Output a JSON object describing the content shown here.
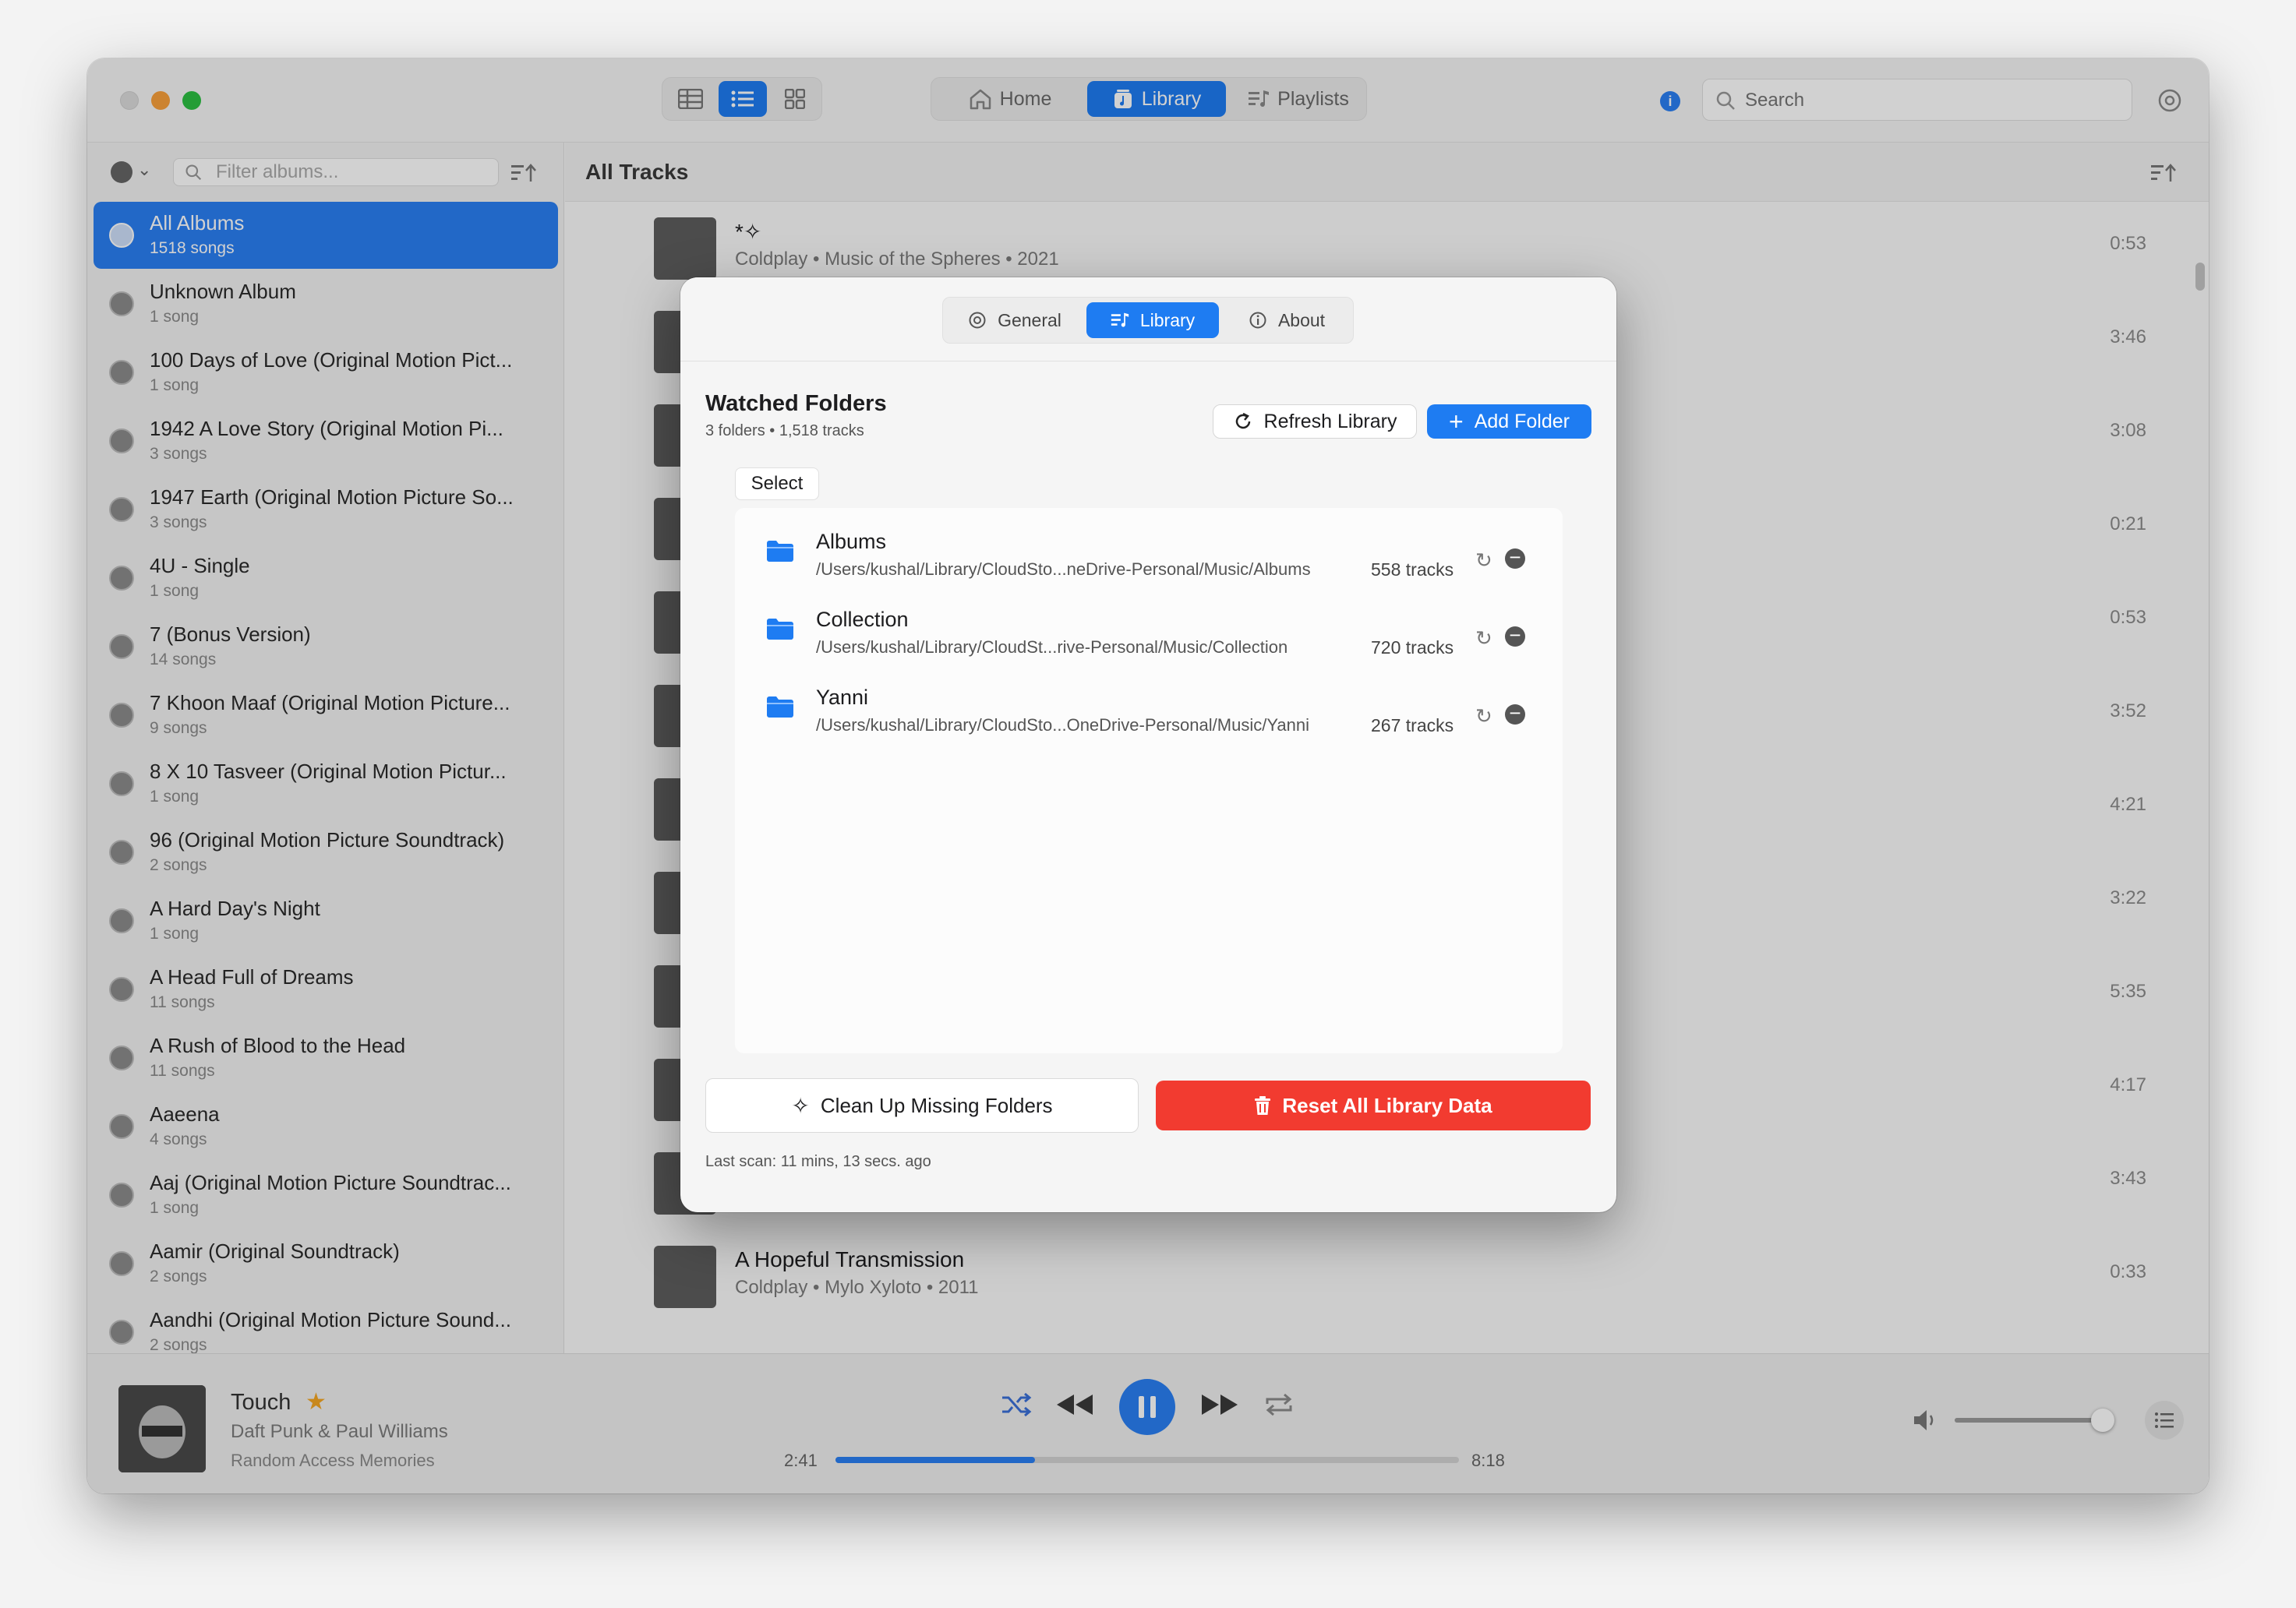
{
  "toolbar": {
    "nav_tabs": [
      {
        "label": "Home",
        "icon": "home-icon"
      },
      {
        "label": "Library",
        "icon": "library-icon"
      },
      {
        "label": "Playlists",
        "icon": "playlists-icon"
      }
    ],
    "search_placeholder": "Search"
  },
  "sidebar": {
    "filter_placeholder": "Filter albums...",
    "albums": [
      {
        "title": "All Albums",
        "subtitle": "1518 songs"
      },
      {
        "title": "Unknown Album",
        "subtitle": "1 song"
      },
      {
        "title": "100 Days of Love (Original Motion Pict...",
        "subtitle": "1 song"
      },
      {
        "title": "1942 A Love Story (Original Motion Pi...",
        "subtitle": "3 songs"
      },
      {
        "title": "1947 Earth (Original Motion Picture So...",
        "subtitle": "3 songs"
      },
      {
        "title": "4U - Single",
        "subtitle": "1 song"
      },
      {
        "title": "7 (Bonus Version)",
        "subtitle": "14 songs"
      },
      {
        "title": "7 Khoon Maaf (Original Motion Picture...",
        "subtitle": "9 songs"
      },
      {
        "title": "8 X 10 Tasveer (Original Motion Pictur...",
        "subtitle": "1 song"
      },
      {
        "title": "96 (Original Motion Picture Soundtrack)",
        "subtitle": "2 songs"
      },
      {
        "title": "A Hard Day's Night",
        "subtitle": "1 song"
      },
      {
        "title": "A Head Full of Dreams",
        "subtitle": "11 songs"
      },
      {
        "title": "A Rush of Blood to the Head",
        "subtitle": "11 songs"
      },
      {
        "title": "Aaeena",
        "subtitle": "4 songs"
      },
      {
        "title": "Aaj (Original Motion Picture Soundtrac...",
        "subtitle": "1 song"
      },
      {
        "title": "Aamir (Original Soundtrack)",
        "subtitle": "2 songs"
      },
      {
        "title": "Aandhi (Original Motion Picture Sound...",
        "subtitle": "2 songs"
      }
    ]
  },
  "main": {
    "title": "All Tracks",
    "tracks": [
      {
        "title": "*✧",
        "subtitle": "Coldplay  •  Music of the Spheres  •  2021",
        "duration": "0:53"
      },
      {
        "title": "",
        "subtitle": "",
        "duration": "3:46"
      },
      {
        "title": "",
        "subtitle": "",
        "duration": "3:08"
      },
      {
        "title": "",
        "subtitle": "",
        "duration": "0:21"
      },
      {
        "title": "",
        "subtitle": "",
        "duration": "0:53"
      },
      {
        "title": "",
        "subtitle": "",
        "duration": "3:52"
      },
      {
        "title": "",
        "subtitle": "",
        "duration": "4:21"
      },
      {
        "title": "",
        "subtitle": "",
        "duration": "3:22"
      },
      {
        "title": "",
        "subtitle": "",
        "duration": "5:35"
      },
      {
        "title": "",
        "subtitle": "",
        "duration": "4:17"
      },
      {
        "title": "",
        "subtitle": "",
        "duration": "3:43"
      },
      {
        "title": "A Hopeful Transmission",
        "subtitle": "Coldplay  •  Mylo Xyloto  •  2011",
        "duration": "0:33"
      }
    ]
  },
  "player": {
    "title": "Touch",
    "artist": "Daft Punk & Paul Williams",
    "album": "Random Access Memories",
    "elapsed": "2:41",
    "total": "8:18",
    "progress": 0.32,
    "volume": 0.95
  },
  "settings": {
    "tabs": [
      {
        "label": "General",
        "icon": "gear-icon"
      },
      {
        "label": "Library",
        "icon": "library-icon"
      },
      {
        "label": "About",
        "icon": "info-icon"
      }
    ],
    "active_tab": "Library",
    "heading": "Watched Folders",
    "subheading": "3 folders • 1,518 tracks",
    "refresh_label": "Refresh Library",
    "add_label": "Add Folder",
    "select_label": "Select",
    "folders": [
      {
        "name": "Albums",
        "path": "/Users/kushal/Library/CloudSto...neDrive-Personal/Music/Albums",
        "count": "558 tracks"
      },
      {
        "name": "Collection",
        "path": "/Users/kushal/Library/CloudSt...rive-Personal/Music/Collection",
        "count": "720 tracks"
      },
      {
        "name": "Yanni",
        "path": "/Users/kushal/Library/CloudSto...OneDrive-Personal/Music/Yanni",
        "count": "267 tracks"
      }
    ],
    "cleanup_label": "Clean Up Missing Folders",
    "reset_label": "Reset All Library Data",
    "last_scan": "Last scan: 11 mins, 13 secs. ago"
  },
  "colors": {
    "accent": "#1e7cf2",
    "danger": "#f23b30",
    "star": "#f5a623"
  }
}
